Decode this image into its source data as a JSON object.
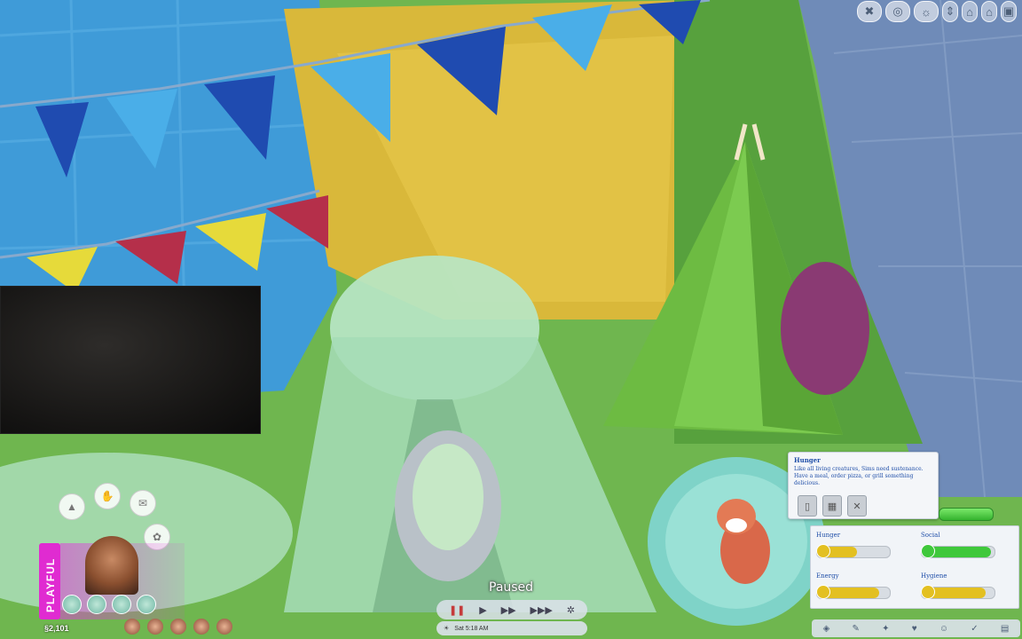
{
  "hud": {
    "status": "Paused",
    "clock": "Sat 5:18 AM",
    "funds": "§2,101"
  },
  "top_toolbar": {
    "icons": [
      "tools-icon",
      "map-icon",
      "lightbulb-icon",
      "arrows-icon",
      "house-icon",
      "house-outline-icon",
      "camera-icon"
    ]
  },
  "speed_controls": {
    "pause_glyph": "❚❚",
    "play_glyph": "▶",
    "fast_glyph": "▶▶",
    "ultra_glyph": "▶▶▶"
  },
  "tooltip": {
    "title": "Hunger",
    "body": "Like all living creatures, Sims need sustenance. Have a meal, order pizza, or grill something delicious."
  },
  "needs": [
    {
      "label": "Hunger",
      "level": 0.55,
      "color": "#e3c021"
    },
    {
      "label": "Social",
      "level": 0.95,
      "color": "#3fc83b"
    },
    {
      "label": "Energy",
      "level": 0.85,
      "color": "#e3c021"
    },
    {
      "label": "Hygiene",
      "level": 0.88,
      "color": "#e3c021"
    }
  ],
  "sim_panel": {
    "emotion": "PLAYFUL",
    "emotion_color": "#e02bd1"
  }
}
